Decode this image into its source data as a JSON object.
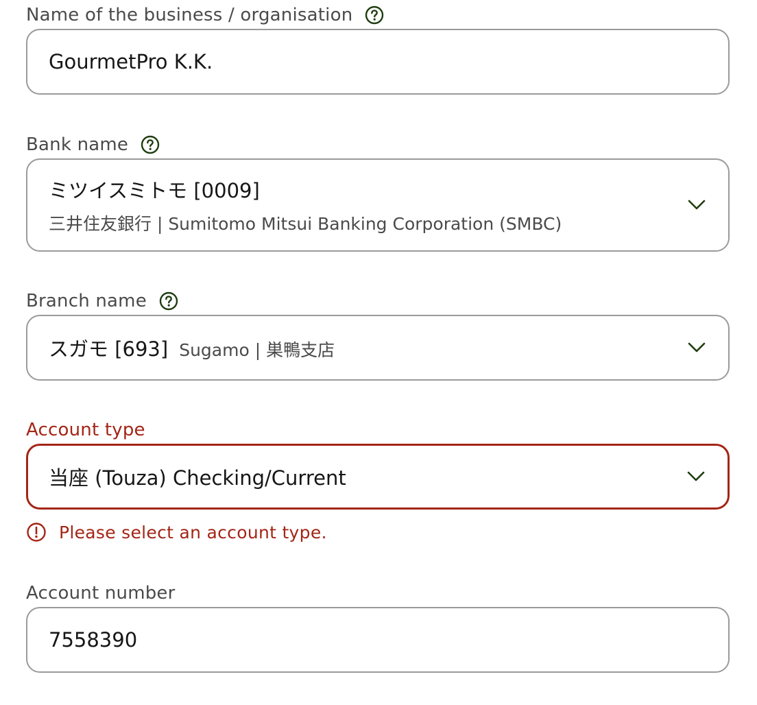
{
  "business_name": {
    "label": "Name of the business / organisation",
    "value": "GourmetPro K.K.",
    "help_icon": "question-circle-icon"
  },
  "bank_name": {
    "label": "Bank name",
    "value": "ミツイスミトモ [0009]",
    "subtext": "三井住友銀行 | Sumitomo Mitsui Banking Corporation (SMBC)",
    "help_icon": "question-circle-icon",
    "dropdown_icon": "chevron-down-icon"
  },
  "branch_name": {
    "label": "Branch name",
    "value": "スガモ [693]",
    "subtext": "Sugamo | 巣鴨支店",
    "help_icon": "question-circle-icon",
    "dropdown_icon": "chevron-down-icon"
  },
  "account_type": {
    "label": "Account type",
    "value": "当座 (Touza) Checking/Current",
    "error": "Please select an account type.",
    "error_icon": "alert-circle-icon",
    "dropdown_icon": "chevron-down-icon"
  },
  "account_number": {
    "label": "Account number",
    "value": "7558390"
  },
  "colors": {
    "error": "#a32516",
    "border": "#9a9a9a",
    "help_icon": "#1f3d10",
    "chevron": "#1f3d10"
  }
}
